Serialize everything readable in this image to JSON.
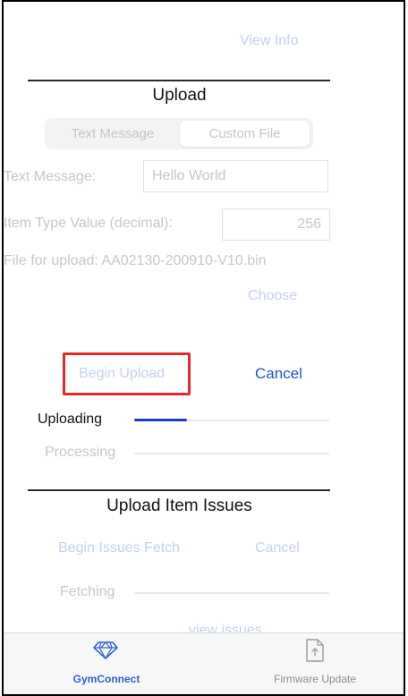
{
  "header": {
    "view_info_label": "View Info"
  },
  "upload": {
    "title": "Upload",
    "segments": [
      {
        "label": "Text Message",
        "selected": false
      },
      {
        "label": "Custom File",
        "selected": true
      }
    ],
    "text_message_label": "Text Message:",
    "text_message_value": "Hello World",
    "item_type_label": "Item Type Value (decimal):",
    "item_type_value": "256",
    "file_label": "File for upload: AA02130-200910-V10.bin",
    "choose_label": "Choose",
    "begin_upload_label": "Begin Upload",
    "cancel_label": "Cancel",
    "uploading_label": "Uploading",
    "uploading_progress": 0.27,
    "processing_label": "Processing",
    "processing_progress": 0
  },
  "issues": {
    "title": "Upload Item Issues",
    "begin_fetch_label": "Begin Issues Fetch",
    "cancel_label": "Cancel",
    "fetching_label": "Fetching",
    "fetching_progress": 0,
    "view_issues_label": "view issues"
  },
  "tabbar": {
    "tabs": [
      {
        "label": "GymConnect",
        "icon": "diamond-icon",
        "active": true
      },
      {
        "label": "Firmware Update",
        "icon": "upload-document-icon",
        "active": false
      }
    ]
  },
  "colors": {
    "accent": "#1a56d6",
    "progress": "#1a3fc8",
    "highlight": "#e42b2b",
    "disabled_link": "#c5d3f0"
  }
}
